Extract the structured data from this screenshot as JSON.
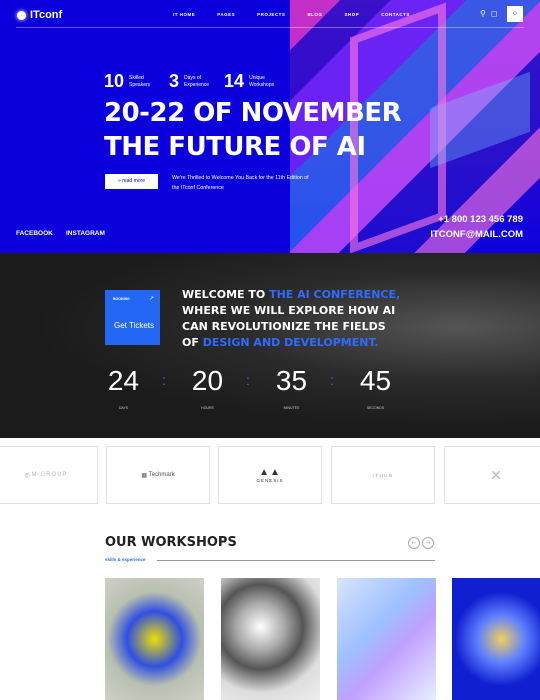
{
  "header": {
    "logo": "ITconf",
    "nav": [
      "IT HOME",
      "PAGES",
      "PROJECTS",
      "BLOG",
      "SHOP",
      "CONTACTS"
    ]
  },
  "stats": [
    {
      "num": "10",
      "label": "Skilled Speakers"
    },
    {
      "num": "3",
      "label": "Days of Experience"
    },
    {
      "num": "14",
      "label": "Unique Workshops"
    }
  ],
  "hero": {
    "line1": "20-22 OF NOVEMBER",
    "line2": "THE FUTURE OF AI",
    "read_more": "read more",
    "intro": "We're Thrilled to Welcome You Back for the 11th Edition of the ITconf Conference",
    "facebook": "FACEBOOK",
    "instagram": "INSTAGRAM",
    "phone": "+1 800 123 456 789",
    "email": "ITCONF@MAIL.COM"
  },
  "booking": {
    "label": "BOOKING",
    "cta": "Get Tickets"
  },
  "welcome": {
    "p1": "WELCOME TO ",
    "a1": "THE AI CONFERENCE,",
    "p2": " WHERE WE WILL EXPLORE HOW AI CAN REVOLUTIONIZE THE FIELDS OF ",
    "a2": "DESIGN AND DEVELOPMENT."
  },
  "countdown": [
    {
      "value": "24",
      "unit": "DAYS"
    },
    {
      "value": "20",
      "unit": "HOURS"
    },
    {
      "value": "35",
      "unit": "MINUTES"
    },
    {
      "value": "45",
      "unit": "SECONDS"
    }
  ],
  "partners": [
    "M-GROUP",
    "Techmark",
    "GENESIS",
    "ITHUB",
    ""
  ],
  "workshops": {
    "title": "OUR WORKSHOPS",
    "subtitle": "skills & experience"
  },
  "colors": {
    "primary": "#0b00dc",
    "accent": "#2567f5"
  }
}
